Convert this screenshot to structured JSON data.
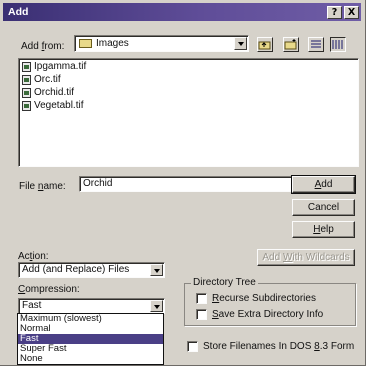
{
  "window": {
    "title": "Add",
    "help_btn": "?",
    "close_btn": "X"
  },
  "add_from": {
    "label_pre": "Add ",
    "label_u": "f",
    "label_post": "rom:",
    "value": "Images"
  },
  "files": [
    "Ipgamma.tif",
    "Orc.tif",
    "Orchid.tif",
    "Vegetabl.tif"
  ],
  "file_name": {
    "label_pre": "File ",
    "label_u": "n",
    "label_post": "ame:",
    "value": "Orchid"
  },
  "buttons": {
    "add": {
      "u": "A",
      "rest": "dd"
    },
    "cancel": "Cancel",
    "help": {
      "u": "H",
      "rest": "elp"
    },
    "add_wildcards": {
      "pre": "Add ",
      "u": "W",
      "post": "ith Wildcards"
    }
  },
  "action": {
    "label_pre": "Ac",
    "label_u": "t",
    "label_post": "ion:",
    "value": "Add (and Replace) Files"
  },
  "compression": {
    "label_pre": "",
    "label_u": "C",
    "label_post": "ompression:",
    "value": "Fast",
    "options": [
      "Maximum (slowest)",
      "Normal",
      "Fast",
      "Super Fast",
      "None"
    ],
    "selected": 2
  },
  "directory_tree": {
    "title": "Directory Tree",
    "recurse": {
      "pre": "",
      "u": "R",
      "post": "ecurse Subdirectories"
    },
    "save_extra": {
      "pre": "",
      "u": "S",
      "post": "ave Extra Directory Info"
    }
  },
  "store_83": {
    "pre": "Store Filenames In DOS ",
    "u": "8",
    "post": ".3 Form"
  }
}
